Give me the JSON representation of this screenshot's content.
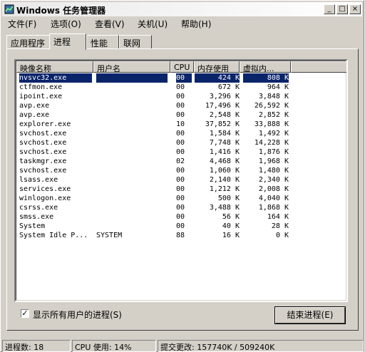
{
  "window": {
    "title": "Windows 任务管理器",
    "min_label": "_",
    "max_label": "□",
    "close_label": "×"
  },
  "menu": [
    "文件(F)",
    "选项(O)",
    "查看(V)",
    "关机(U)",
    "帮助(H)"
  ],
  "tabs": [
    "应用程序",
    "进程",
    "性能",
    "联网"
  ],
  "active_tab": "进程",
  "columns": [
    "映像名称",
    "用户名",
    "CPU",
    "内存使用",
    "虚拟内..."
  ],
  "processes": [
    {
      "name": "nvsvc32.exe",
      "user": "",
      "cpu": "00",
      "mem": "424 K",
      "vm": "808 K",
      "selected": true
    },
    {
      "name": "ctfmon.exe",
      "user": "",
      "cpu": "00",
      "mem": "672 K",
      "vm": "964 K"
    },
    {
      "name": "ipoint.exe",
      "user": "",
      "cpu": "00",
      "mem": "3,296 K",
      "vm": "3,848 K"
    },
    {
      "name": "avp.exe",
      "user": "",
      "cpu": "00",
      "mem": "17,496 K",
      "vm": "26,592 K"
    },
    {
      "name": "avp.exe",
      "user": "",
      "cpu": "00",
      "mem": "2,548 K",
      "vm": "2,852 K"
    },
    {
      "name": "explorer.exe",
      "user": "",
      "cpu": "10",
      "mem": "37,852 K",
      "vm": "33,888 K"
    },
    {
      "name": "svchost.exe",
      "user": "",
      "cpu": "00",
      "mem": "1,584 K",
      "vm": "1,492 K"
    },
    {
      "name": "svchost.exe",
      "user": "",
      "cpu": "00",
      "mem": "7,748 K",
      "vm": "14,228 K"
    },
    {
      "name": "svchost.exe",
      "user": "",
      "cpu": "00",
      "mem": "1,416 K",
      "vm": "1,876 K"
    },
    {
      "name": "taskmgr.exe",
      "user": "",
      "cpu": "02",
      "mem": "4,468 K",
      "vm": "1,968 K"
    },
    {
      "name": "svchost.exe",
      "user": "",
      "cpu": "00",
      "mem": "1,060 K",
      "vm": "1,480 K"
    },
    {
      "name": "lsass.exe",
      "user": "",
      "cpu": "00",
      "mem": "2,140 K",
      "vm": "2,340 K"
    },
    {
      "name": "services.exe",
      "user": "",
      "cpu": "00",
      "mem": "1,212 K",
      "vm": "2,008 K"
    },
    {
      "name": "winlogon.exe",
      "user": "",
      "cpu": "00",
      "mem": "500 K",
      "vm": "4,040 K"
    },
    {
      "name": "csrss.exe",
      "user": "",
      "cpu": "00",
      "mem": "3,488 K",
      "vm": "1,868 K"
    },
    {
      "name": "smss.exe",
      "user": "",
      "cpu": "00",
      "mem": "56 K",
      "vm": "164 K"
    },
    {
      "name": "System",
      "user": "",
      "cpu": "00",
      "mem": "40 K",
      "vm": "28 K"
    },
    {
      "name": "System Idle P...",
      "user": "SYSTEM",
      "cpu": "88",
      "mem": "16 K",
      "vm": "0 K"
    }
  ],
  "show_all_users": {
    "label": "显示所有用户的进程(S)",
    "checked": true,
    "check_glyph": "✓"
  },
  "end_process_label": "结束进程(E)",
  "status": {
    "processes": "进程数: 18",
    "cpu": "CPU 使用: 14%",
    "commit": "提交更改: 157740K / 509240K"
  }
}
